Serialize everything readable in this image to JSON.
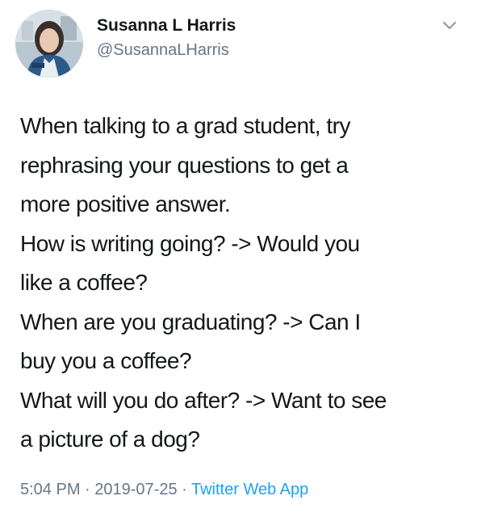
{
  "user": {
    "display_name": "Susanna L Harris",
    "handle": "@SusannaLHarris"
  },
  "tweet": {
    "lines": [
      "When talking to a grad student, try",
      "rephrasing your questions to get a",
      "more positive answer.",
      "How is writing going? -> Would you",
      "like a coffee?",
      "When are you graduating? -> Can I",
      "buy you a coffee?",
      "What will you do after? -> Want to see",
      "a picture of a dog?"
    ]
  },
  "meta": {
    "time": "5:04 PM",
    "separator": " · ",
    "date": "2019-07-25",
    "source": "Twitter Web App"
  },
  "icons": {
    "menu": "chevron-down-icon",
    "avatar": "avatar"
  },
  "colors": {
    "text": "#14171a",
    "secondary": "#657786",
    "link": "#1da1f2"
  }
}
